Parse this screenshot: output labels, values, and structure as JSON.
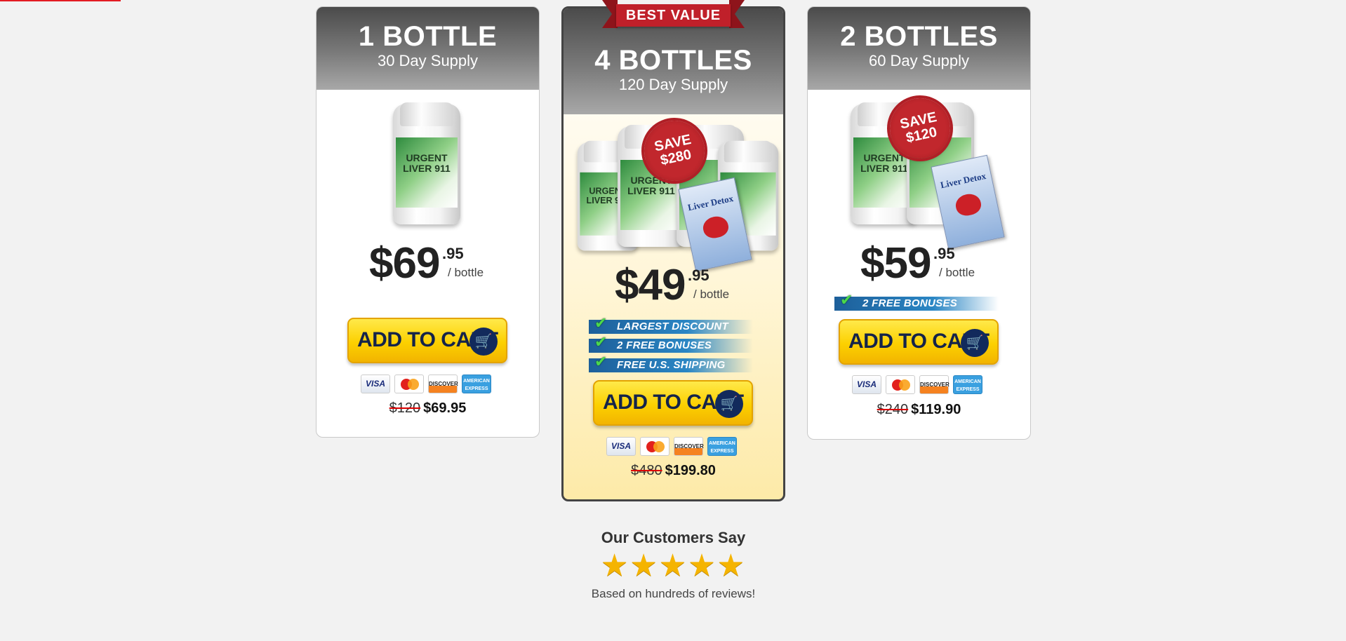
{
  "plans": {
    "left": {
      "qty": "1 BOTTLE",
      "supply": "30 Day Supply",
      "price_dollars": "$69",
      "price_cents": ".95",
      "per": "/ bottle",
      "cart_label": "ADD TO CART",
      "old_total": "$120",
      "total": "$69.95",
      "product_label": "URGENT LIVER 911"
    },
    "mid": {
      "badge": "BEST VALUE",
      "qty": "4 BOTTLES",
      "supply": "120 Day Supply",
      "save_line1": "SAVE",
      "save_line2": "$280",
      "price_dollars": "$49",
      "price_cents": ".95",
      "per": "/ bottle",
      "perks": [
        "LARGEST DISCOUNT",
        "2 FREE BONUSES",
        "FREE U.S. SHIPPING"
      ],
      "cart_label": "ADD TO CART",
      "old_total": "$480",
      "total": "$199.80",
      "product_label": "URGENT LIVER 911",
      "book_title": "Liver Detox"
    },
    "right": {
      "qty": "2 BOTTLES",
      "supply": "60 Day Supply",
      "save_line1": "SAVE",
      "save_line2": "$120",
      "price_dollars": "$59",
      "price_cents": ".95",
      "per": "/ bottle",
      "perks": [
        "2 FREE BONUSES"
      ],
      "cart_label": "ADD TO CART",
      "old_total": "$240",
      "total": "$119.90",
      "product_label": "URGENT LIVER 911",
      "book_title": "Liver Detox"
    }
  },
  "payment_cards": {
    "visa": "VISA",
    "mastercard": "MasterCard",
    "discover": "DISCOVER",
    "amex": "AMERICAN EXPRESS"
  },
  "reviews": {
    "title": "Our Customers Say",
    "stars": "★★★★★",
    "rating": 5,
    "subtitle": "Based on hundreds of reviews!"
  },
  "colors": {
    "accent_red": "#c0202a",
    "cart_yellow": "#fcd000",
    "cart_navy": "#122a5c",
    "perk_blue": "#2a86c4",
    "check_green": "#4cd84c",
    "star_gold": "#f5b400"
  }
}
